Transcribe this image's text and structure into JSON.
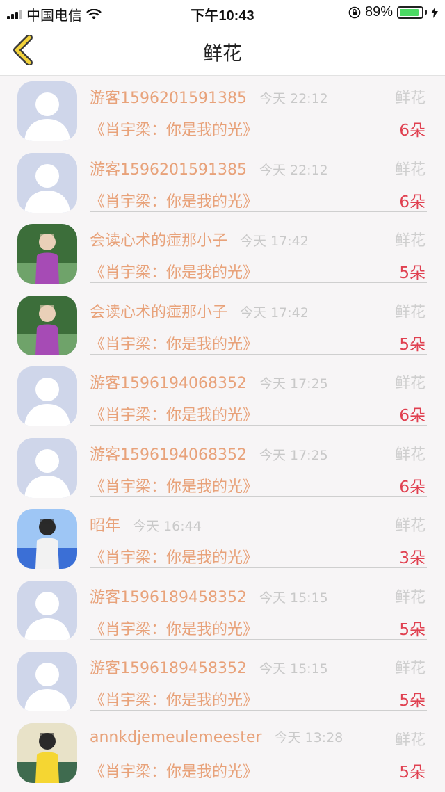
{
  "status_bar": {
    "carrier": "中国电信",
    "time": "下午10:43",
    "battery_percent": "89%",
    "battery_level": 0.89
  },
  "nav": {
    "title": "鲜花"
  },
  "colors": {
    "accent_orange": "#e8a27a",
    "count_red": "#e04050",
    "muted_gray": "#c9c9c9"
  },
  "records": [
    {
      "user": "游客1596201591385",
      "time": "今天 22:12",
      "gift": "鲜花",
      "book": "《肖宇梁：你是我的光》",
      "count": "6朵",
      "avatar": "default-avatar"
    },
    {
      "user": "游客1596201591385",
      "time": "今天 22:12",
      "gift": "鲜花",
      "book": "《肖宇梁：你是我的光》",
      "count": "6朵",
      "avatar": "default-avatar"
    },
    {
      "user": "会读心术的痖那小子",
      "time": "今天 17:42",
      "gift": "鲜花",
      "book": "《肖宇梁：你是我的光》",
      "count": "5朵",
      "avatar": "photo-avatar"
    },
    {
      "user": "会读心术的痖那小子",
      "time": "今天 17:42",
      "gift": "鲜花",
      "book": "《肖宇梁：你是我的光》",
      "count": "5朵",
      "avatar": "photo-avatar"
    },
    {
      "user": "游客1596194068352",
      "time": "今天 17:25",
      "gift": "鲜花",
      "book": "《肖宇梁：你是我的光》",
      "count": "6朵",
      "avatar": "default-avatar"
    },
    {
      "user": "游客1596194068352",
      "time": "今天 17:25",
      "gift": "鲜花",
      "book": "《肖宇梁：你是我的光》",
      "count": "6朵",
      "avatar": "default-avatar"
    },
    {
      "user": "昭年",
      "time": "今天 16:44",
      "gift": "鲜花",
      "book": "《肖宇梁：你是我的光》",
      "count": "3朵",
      "avatar": "photo-avatar"
    },
    {
      "user": "游客1596189458352",
      "time": "今天 15:15",
      "gift": "鲜花",
      "book": "《肖宇梁：你是我的光》",
      "count": "5朵",
      "avatar": "default-avatar"
    },
    {
      "user": "游客1596189458352",
      "time": "今天 15:15",
      "gift": "鲜花",
      "book": "《肖宇梁：你是我的光》",
      "count": "5朵",
      "avatar": "default-avatar"
    },
    {
      "user": "annkdjemeulemeester",
      "time": "今天 13:28",
      "gift": "鲜花",
      "book": "《肖宇梁：你是我的光》",
      "count": "5朵",
      "avatar": "photo-avatar"
    }
  ]
}
